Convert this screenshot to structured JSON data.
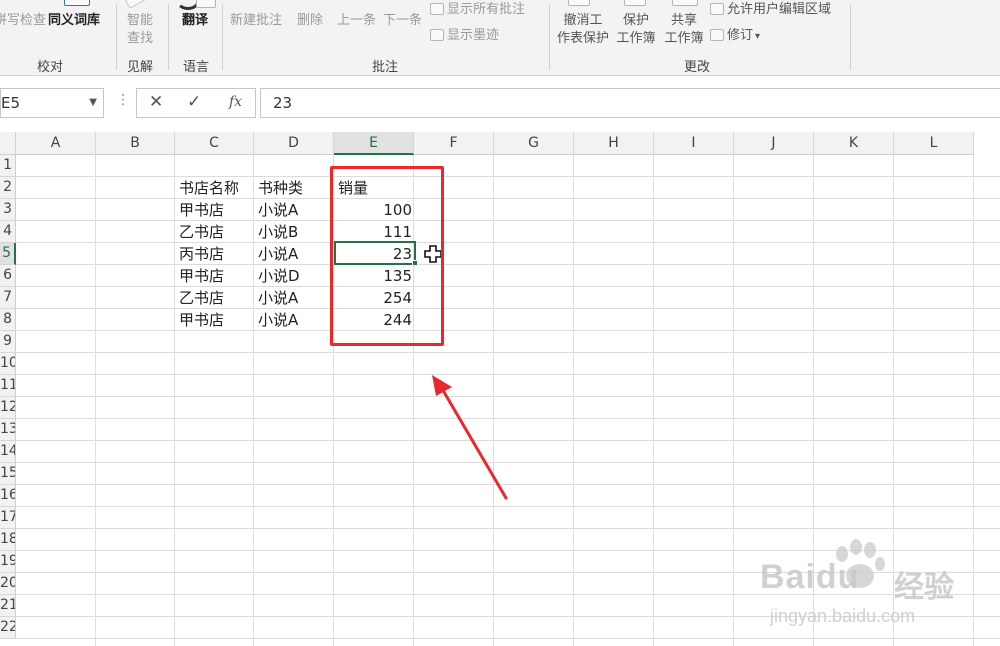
{
  "ribbon": {
    "proofing": {
      "spell_check": "拼写检查",
      "thesaurus": "同义词库",
      "label": "校对"
    },
    "insights": {
      "smart_lookup_line1": "智能",
      "smart_lookup_line2": "查找",
      "label": "见解"
    },
    "language": {
      "translate": "翻译",
      "label": "语言"
    },
    "comments": {
      "new_comment": "新建批注",
      "delete": "删除",
      "previous": "上一条",
      "next": "下一条",
      "show_all": "显示所有批注",
      "show_ink": "显示墨迹",
      "label": "批注"
    },
    "changes": {
      "unprotect_line1": "撤消工",
      "unprotect_line2": "作表保护",
      "protect_line1": "保护",
      "protect_line2": "工作簿",
      "share_line1": "共享",
      "share_line2": "工作簿",
      "allow_edit_ranges": "允许用户编辑区域",
      "track_changes": "修订",
      "label": "更改"
    }
  },
  "formula_bar": {
    "name_box": "E5",
    "cancel_icon": "✕",
    "enter_icon": "✓",
    "fx_icon": "fx",
    "value": "23"
  },
  "columns": [
    "A",
    "B",
    "C",
    "D",
    "E",
    "F",
    "G",
    "H",
    "I",
    "J",
    "K",
    "L"
  ],
  "rows": [
    "1",
    "2",
    "3",
    "4",
    "5",
    "6",
    "7",
    "8",
    "9",
    "10",
    "11",
    "12",
    "13",
    "14",
    "15",
    "16",
    "17",
    "18",
    "19",
    "20",
    "21",
    "22"
  ],
  "active_column": "E",
  "active_row": "5",
  "table": {
    "headers": [
      "书店名称",
      "书种类",
      "销量"
    ],
    "rows": [
      [
        "甲书店",
        "小说A",
        "100"
      ],
      [
        "乙书店",
        "小说B",
        "111"
      ],
      [
        "丙书店",
        "小说A",
        "23"
      ],
      [
        "甲书店",
        "小说D",
        "135"
      ],
      [
        "乙书店",
        "小说A",
        "254"
      ],
      [
        "甲书店",
        "小说A",
        "244"
      ]
    ]
  },
  "colors": {
    "excel_green": "#217346",
    "annotation_red": "#e8282b"
  },
  "icons": {
    "cursor": "cell-select-cursor-icon",
    "arrow": "annotation-arrow-icon"
  },
  "watermark": {
    "brand": "Baidu",
    "brand_cn": "经验",
    "url": "jingyan.baidu.com"
  }
}
